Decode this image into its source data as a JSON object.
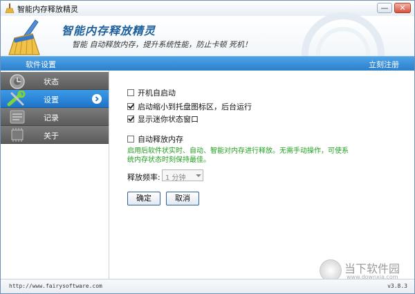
{
  "window": {
    "title": "智能内存释放精灵",
    "min_label": "—",
    "close_label": "✕"
  },
  "header": {
    "app_name": "智能内存释放精灵",
    "slogan": "智能 自动释放内存，提升系统性能，防止卡顿 死机！"
  },
  "bluebar": {
    "left_label": "软件设置",
    "register_label": "立刻注册"
  },
  "sidebar": {
    "items": [
      {
        "label": "状态",
        "icon": "clock-gear-icon",
        "active": false
      },
      {
        "label": "设置",
        "icon": "wrench-icon",
        "active": true
      },
      {
        "label": "记录",
        "icon": "record-icon",
        "active": false
      },
      {
        "label": "关于",
        "icon": "chip-icon",
        "active": false
      }
    ]
  },
  "settings": {
    "autostart": {
      "label": "开机自启动",
      "checked": false
    },
    "minimize_to_tray": {
      "label": "启动缩小到托盘图标区，后台运行",
      "checked": true
    },
    "mini_window": {
      "label": "显示迷你状态窗口",
      "checked": true
    },
    "auto_release": {
      "label": "自动释放内存",
      "checked": false
    },
    "hint": "启用后软件状实时、自动、智能对内存进行释放。无需手动操作，可使系统内存状态时刻保持最佳。",
    "frequency_label": "释放频率:",
    "frequency_value": "1 分钟",
    "ok_label": "确定",
    "cancel_label": "取消"
  },
  "watermark": {
    "text": "当下软件园",
    "url": "www.downxia.com"
  },
  "status": {
    "url": "http://www.fairysoftware.com",
    "version": "v3.8.3"
  },
  "colors": {
    "accent": "#2c7fcc",
    "hint_green": "#22a020",
    "nav_gray": "#5b5b5b"
  }
}
